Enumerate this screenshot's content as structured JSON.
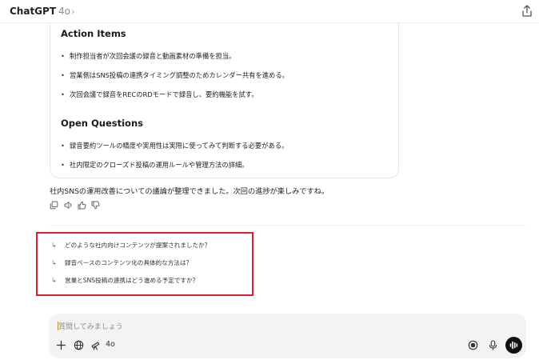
{
  "header": {
    "app_name": "ChatGPT",
    "model": "4o",
    "chevron": "›",
    "share_icon": "share-icon"
  },
  "card": {
    "section1_title": "Action Items",
    "section1_items": [
      "制作担当者が次回会議の録音と動画素材の準備を担当。",
      "営業側はSNS投稿の連携タイミング調整のためカレンダー共有を進める。",
      "次回会議で録音をRECのRDモードで録音し、要約機能を試す。"
    ],
    "section2_title": "Open Questions",
    "section2_items": [
      "録音要約ツールの精度や実用性は実際に使ってみて判断する必要がある。",
      "社内限定のクローズド投稿の運用ルールや管理方法の詳細。"
    ],
    "bullet_glyph": "•"
  },
  "message": {
    "summary": "社内SNSの運用改善についての議論が整理できました。次回の進捗が楽しみですね。"
  },
  "followups": {
    "arrow_glyph": "↳",
    "items": [
      "どのような社内向けコンテンツが提案されましたか？",
      "録音ベースのコンテンツ化の具体的な方法は？",
      "営業とSNS投稿の連携はどう進める予定ですか？"
    ],
    "highlight_color": "#d6232a"
  },
  "composer": {
    "placeholder": "質問してみましょう",
    "model_label": "4o"
  }
}
